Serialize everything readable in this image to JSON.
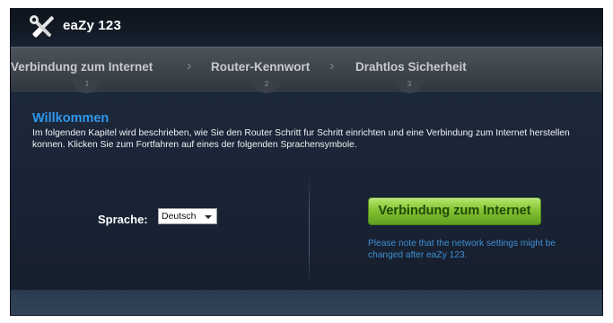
{
  "header": {
    "brand": "eaZy 123",
    "logo_icon": "wrench-screwdriver-icon"
  },
  "steps": [
    {
      "label": "Verbindung zum Internet",
      "number": "1"
    },
    {
      "label": "Router-Kennwort",
      "number": "2"
    },
    {
      "label": "Drahtlos Sicherheit",
      "number": "3"
    }
  ],
  "separator_icon": "chevron-right-icon",
  "main": {
    "title": "Willkommen",
    "description": "Im folgenden Kapitel wird beschrieben, wie Sie den Router Schritt fur Schritt einrichten und eine Verbindung zum Internet herstellen konnen. Klicken Sie zum Fortfahren auf eines der folgenden Sprachensymbole."
  },
  "language": {
    "label": "Sprache:",
    "selected": "Deutsch"
  },
  "connect": {
    "button_label": "Verbindung zum Internet",
    "note": "Please note that the network settings might be changed after eaZy 123."
  },
  "colors": {
    "accent_blue": "#2f97ea",
    "button_green": "#86c334",
    "background": "#1a2436"
  }
}
